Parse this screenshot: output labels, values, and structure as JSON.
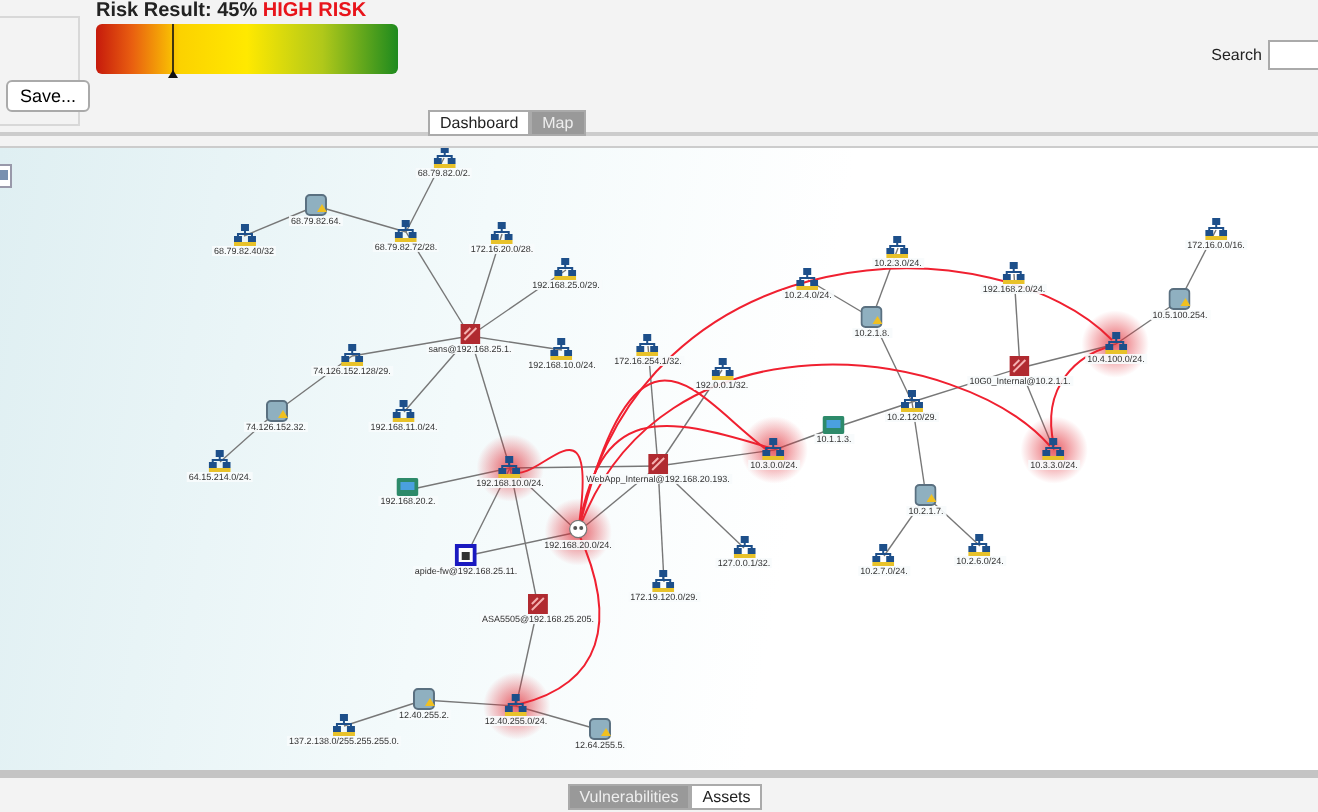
{
  "toolbar": {
    "save_button": "Save...",
    "risk": {
      "label": "Risk Result: 45%",
      "rating": "HIGH RISK",
      "level": 0.25
    },
    "search": {
      "label": "Search"
    }
  },
  "tabs": [
    {
      "label": "Dashboard",
      "selected": false
    },
    {
      "label": "Map",
      "selected": true
    }
  ],
  "map": {
    "nodes": [
      {
        "label": "68.79.82.0/2.",
        "kind": "network",
        "at_risk": false
      },
      {
        "label": "68.79.82.64.",
        "kind": "gateway",
        "at_risk": false
      },
      {
        "label": "68.79.82.40/32",
        "kind": "network",
        "at_risk": false
      },
      {
        "label": "68.79.82.72/28.",
        "kind": "network",
        "at_risk": false
      },
      {
        "label": "172.16.20.0/28.",
        "kind": "network",
        "at_risk": false
      },
      {
        "label": "192.168.25.0/29.",
        "kind": "network",
        "at_risk": false
      },
      {
        "label": "sans@192.168.25.1.",
        "kind": "firewall",
        "at_risk": false
      },
      {
        "label": "192.168.10.0/24.",
        "kind": "network",
        "at_risk": false
      },
      {
        "label": "74.126.152.128/29.",
        "kind": "network",
        "at_risk": false
      },
      {
        "label": "74.126.152.32.",
        "kind": "gateway",
        "at_risk": false
      },
      {
        "label": "192.168.11.0/24.",
        "kind": "network",
        "at_risk": false
      },
      {
        "label": "64.15.214.0/24.",
        "kind": "network",
        "at_risk": false
      },
      {
        "label": "192.168.10.0/24.",
        "kind": "network",
        "at_risk": true
      },
      {
        "label": "172.16.254.1/32.",
        "kind": "network",
        "at_risk": false
      },
      {
        "label": "192.0.0.1/32.",
        "kind": "network",
        "at_risk": false
      },
      {
        "label": "WebApp_Internal@192.168.20.193.",
        "kind": "firewall",
        "at_risk": false
      },
      {
        "label": "10.3.0.0/24.",
        "kind": "network",
        "at_risk": true
      },
      {
        "label": "10.1.1.3.",
        "kind": "host",
        "at_risk": false
      },
      {
        "label": "10.2.4.0/24.",
        "kind": "network",
        "at_risk": false
      },
      {
        "label": "10.2.3.0/24.",
        "kind": "network",
        "at_risk": false
      },
      {
        "label": "10.2.1.8.",
        "kind": "gateway",
        "at_risk": false
      },
      {
        "label": "10.2.120/29.",
        "kind": "network",
        "at_risk": false
      },
      {
        "label": "10.2.1.7.",
        "kind": "gateway",
        "at_risk": false
      },
      {
        "label": "10.2.7.0/24.",
        "kind": "network",
        "at_risk": false
      },
      {
        "label": "10.2.6.0/24.",
        "kind": "network",
        "at_risk": false
      },
      {
        "label": "192.168.2.0/24.",
        "kind": "network",
        "at_risk": false
      },
      {
        "label": "10G0_Internal@10.2.1.1.",
        "kind": "firewall",
        "at_risk": false
      },
      {
        "label": "10.3.3.0/24.",
        "kind": "network",
        "at_risk": true
      },
      {
        "label": "10.4.100.0/24.",
        "kind": "network",
        "at_risk": true
      },
      {
        "label": "10.5.100.254.",
        "kind": "gateway",
        "at_risk": false
      },
      {
        "label": "172.16.0.0/16.",
        "kind": "network",
        "at_risk": false
      },
      {
        "label": "127.0.0.1/32.",
        "kind": "network",
        "at_risk": false
      },
      {
        "label": "172.19.120.0/29.",
        "kind": "network",
        "at_risk": false
      },
      {
        "label": "192.168.20.2.",
        "kind": "host",
        "at_risk": false
      },
      {
        "label": "192.168.20.0/24.",
        "kind": "attacker",
        "at_risk": true
      },
      {
        "label": "apide-fw@192.168.25.11.",
        "kind": "device",
        "at_risk": false
      },
      {
        "label": "ASA5505@192.168.25.205.",
        "kind": "firewall",
        "at_risk": false
      },
      {
        "label": "12.40.255.0/24.",
        "kind": "network",
        "at_risk": true
      },
      {
        "label": "12.40.255.2.",
        "kind": "gateway",
        "at_risk": false
      },
      {
        "label": "137.2.138.0/255.255.255.0.",
        "kind": "network",
        "at_risk": false
      },
      {
        "label": "12.64.255.5.",
        "kind": "gateway",
        "at_risk": false
      }
    ]
  },
  "bottom_tabs": [
    {
      "label": "Vulnerabilities",
      "selected": true
    },
    {
      "label": "Assets",
      "selected": false
    }
  ]
}
